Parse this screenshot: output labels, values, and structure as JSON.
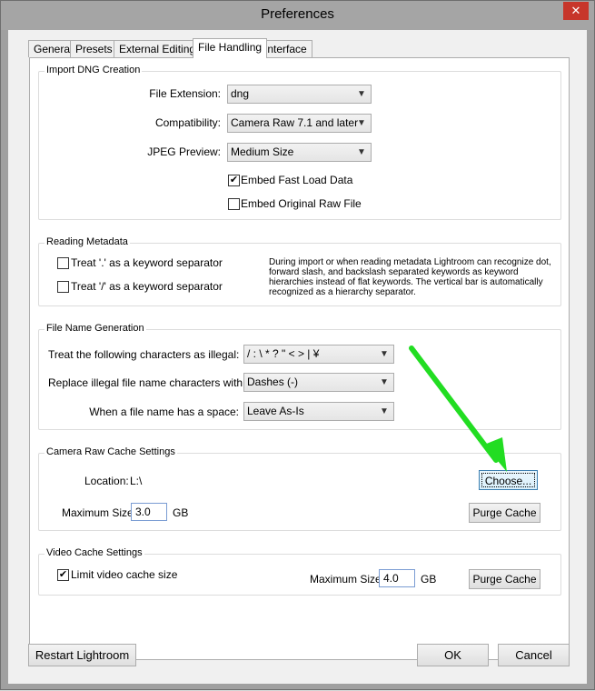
{
  "window": {
    "title": "Preferences",
    "close_glyph": "✕"
  },
  "tabs": [
    "General",
    "Presets",
    "External Editing",
    "File Handling",
    "Interface"
  ],
  "active_tab": "File Handling",
  "import_dng": {
    "title": "Import DNG Creation",
    "file_extension_label": "File Extension:",
    "file_extension_value": "dng",
    "compatibility_label": "Compatibility:",
    "compatibility_value": "Camera Raw 7.1 and later",
    "jpeg_preview_label": "JPEG Preview:",
    "jpeg_preview_value": "Medium Size",
    "embed_fast_load_label": "Embed Fast Load Data",
    "embed_fast_load_checked": true,
    "embed_raw_label": "Embed Original Raw File",
    "embed_raw_checked": false
  },
  "reading_metadata": {
    "title": "Reading Metadata",
    "dot_label": "Treat '.' as a keyword separator",
    "slash_label": "Treat '/' as a keyword separator",
    "description_lines": [
      "During import or when reading metadata Lightroom can recognize dot,",
      "forward slash, and backslash separated keywords as keyword",
      "hierarchies instead of flat keywords. The vertical bar is automatically",
      "recognized as a hierarchy separator."
    ]
  },
  "file_name_generation": {
    "title": "File Name Generation",
    "illegal_label": "Treat the following characters as illegal:",
    "illegal_value": "/ : \\ * ? \" < > | ¥",
    "replace_label": "Replace illegal file name characters with:",
    "replace_value": "Dashes (-)",
    "space_label": "When a file name has a space:",
    "space_value": "Leave As-Is"
  },
  "camera_raw_cache": {
    "title": "Camera Raw Cache Settings",
    "location_label": "Location:",
    "location_value": "L:\\",
    "choose_button": "Choose...",
    "max_size_label": "Maximum Size:",
    "max_size_value": "3.0",
    "unit": "GB",
    "purge_button": "Purge Cache"
  },
  "video_cache": {
    "title": "Video Cache Settings",
    "limit_label": "Limit video cache size",
    "limit_checked": true,
    "max_size_label": "Maximum Size:",
    "max_size_value": "4.0",
    "unit": "GB",
    "purge_button": "Purge Cache"
  },
  "footer": {
    "restart_button": "Restart Lightroom",
    "ok_button": "OK",
    "cancel_button": "Cancel"
  },
  "annotation": {
    "arrow_color": "#22dd22"
  }
}
